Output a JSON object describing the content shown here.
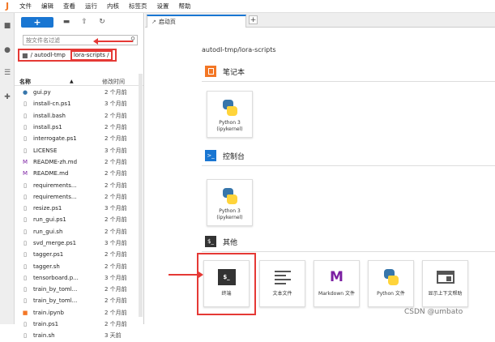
{
  "menubar": {
    "logo": "J",
    "items": [
      "文件",
      "编辑",
      "查看",
      "运行",
      "内核",
      "标签页",
      "设置",
      "帮助"
    ]
  },
  "sidebar": {
    "new_button": "+",
    "filter_placeholder": "按文件名过滤",
    "breadcrumb_root": "/ autodl-tmp",
    "breadcrumb_current": "lora-scripts /",
    "col_name": "名称",
    "col_modified": "修改时间",
    "files": [
      {
        "name": "gui.py",
        "modified": "2 个月前",
        "icon": "python-icon"
      },
      {
        "name": "install-cn.ps1",
        "modified": "3 个月前",
        "icon": "file-icon"
      },
      {
        "name": "install.bash",
        "modified": "2 个月前",
        "icon": "file-icon"
      },
      {
        "name": "install.ps1",
        "modified": "2 个月前",
        "icon": "file-icon"
      },
      {
        "name": "interrogate.ps1",
        "modified": "2 个月前",
        "icon": "file-icon"
      },
      {
        "name": "LICENSE",
        "modified": "3 个月前",
        "icon": "file-icon"
      },
      {
        "name": "README-zh.md",
        "modified": "2 个月前",
        "icon": "markdown-icon"
      },
      {
        "name": "README.md",
        "modified": "2 个月前",
        "icon": "markdown-icon"
      },
      {
        "name": "requirements...",
        "modified": "2 个月前",
        "icon": "file-icon"
      },
      {
        "name": "requirements...",
        "modified": "2 个月前",
        "icon": "file-icon"
      },
      {
        "name": "resize.ps1",
        "modified": "3 个月前",
        "icon": "file-icon"
      },
      {
        "name": "run_gui.ps1",
        "modified": "2 个月前",
        "icon": "file-icon"
      },
      {
        "name": "run_gui.sh",
        "modified": "2 个月前",
        "icon": "file-icon"
      },
      {
        "name": "svd_merge.ps1",
        "modified": "3 个月前",
        "icon": "file-icon"
      },
      {
        "name": "tagger.ps1",
        "modified": "2 个月前",
        "icon": "file-icon"
      },
      {
        "name": "tagger.sh",
        "modified": "2 个月前",
        "icon": "file-icon"
      },
      {
        "name": "tensorboard.p...",
        "modified": "3 个月前",
        "icon": "file-icon"
      },
      {
        "name": "train_by_toml...",
        "modified": "2 个月前",
        "icon": "file-icon"
      },
      {
        "name": "train_by_toml...",
        "modified": "2 个月前",
        "icon": "file-icon"
      },
      {
        "name": "train.ipynb",
        "modified": "2 个月前",
        "icon": "notebook-icon"
      },
      {
        "name": "train.ps1",
        "modified": "2 个月前",
        "icon": "file-icon"
      },
      {
        "name": "train.sh",
        "modified": "3 天前",
        "icon": "file-icon"
      }
    ]
  },
  "main": {
    "tab_label": "启动页",
    "path": "autodl-tmp/lora-scripts",
    "sections": {
      "notebook": "笔记本",
      "console": "控制台",
      "other": "其他"
    },
    "notebook_card": "Python 3\n(ipykernel)",
    "console_card": "Python 3\n(ipykernel)",
    "other_cards": [
      "终端",
      "文本文件",
      "Markdown 文件",
      "Python 文件",
      "显示上下文帮助"
    ]
  },
  "watermark": "CSDN @umbato",
  "colors": {
    "accent": "#1976d2",
    "highlight": "#e53935",
    "jupyter": "#f37726"
  }
}
